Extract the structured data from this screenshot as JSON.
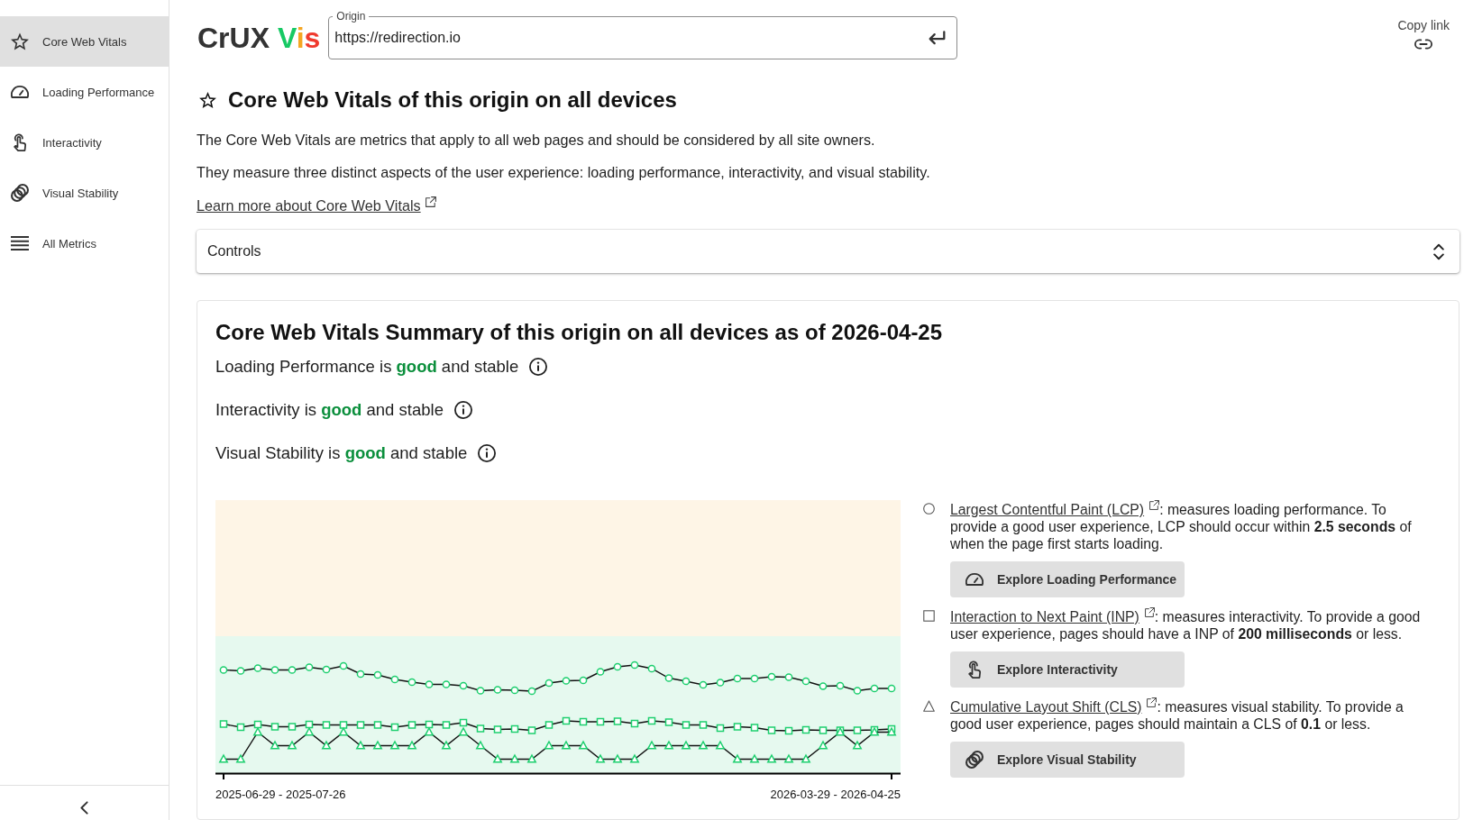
{
  "sidebar": {
    "items": [
      {
        "label": "Core Web Vitals",
        "selected": true
      },
      {
        "label": "Loading Performance",
        "selected": false
      },
      {
        "label": "Interactivity",
        "selected": false
      },
      {
        "label": "Visual Stability",
        "selected": false
      },
      {
        "label": "All Metrics",
        "selected": false
      }
    ]
  },
  "header": {
    "logo": {
      "name": "CrUX",
      "accent": "Vis"
    },
    "origin_field": {
      "label": "Origin",
      "value": "https://redirection.io"
    },
    "copy_link": "Copy link"
  },
  "intro": {
    "heading": "Core Web Vitals of this origin on all devices",
    "paragraphs": [
      "The Core Web Vitals are metrics that apply to all web pages and should be considered by all site owners.",
      "They measure three distinct aspects of the user experience: loading performance, interactivity, and visual stability."
    ],
    "link": "Learn more about Core Web Vitals"
  },
  "controls": {
    "label": "Controls"
  },
  "summary": {
    "title": "Core Web Vitals Summary of this origin on all devices as of 2026-04-25",
    "assessments": [
      {
        "subject": "Loading Performance is",
        "rating": "good",
        "trend": "and stable"
      },
      {
        "subject": "Interactivity is",
        "rating": "good",
        "trend": "and stable"
      },
      {
        "subject": "Visual Stability is",
        "rating": "good",
        "trend": "and stable"
      }
    ],
    "chart": {
      "x_labels": [
        "2025-06-29 - 2025-07-26",
        "2026-03-29 - 2026-04-25"
      ]
    },
    "metrics": [
      {
        "link": "Largest Contentful Paint (LCP)",
        "description": ": measures loading performance. To provide a good user experience, LCP should occur within **2.5 seconds** of when the page first starts loading.",
        "button": "Explore Loading Performance"
      },
      {
        "link": "Interaction to Next Paint (INP)",
        "description": ": measures interactivity. To provide a good user experience, pages should have a INP of **200 milliseconds** or less.",
        "button": "Explore Interactivity"
      },
      {
        "link": "Cumulative Layout Shift (CLS)",
        "description": ": measures visual stability. To provide a good user experience, pages should maintain a CLS of **0.1** or less.",
        "button": "Explore Visual Stability"
      }
    ]
  }
}
